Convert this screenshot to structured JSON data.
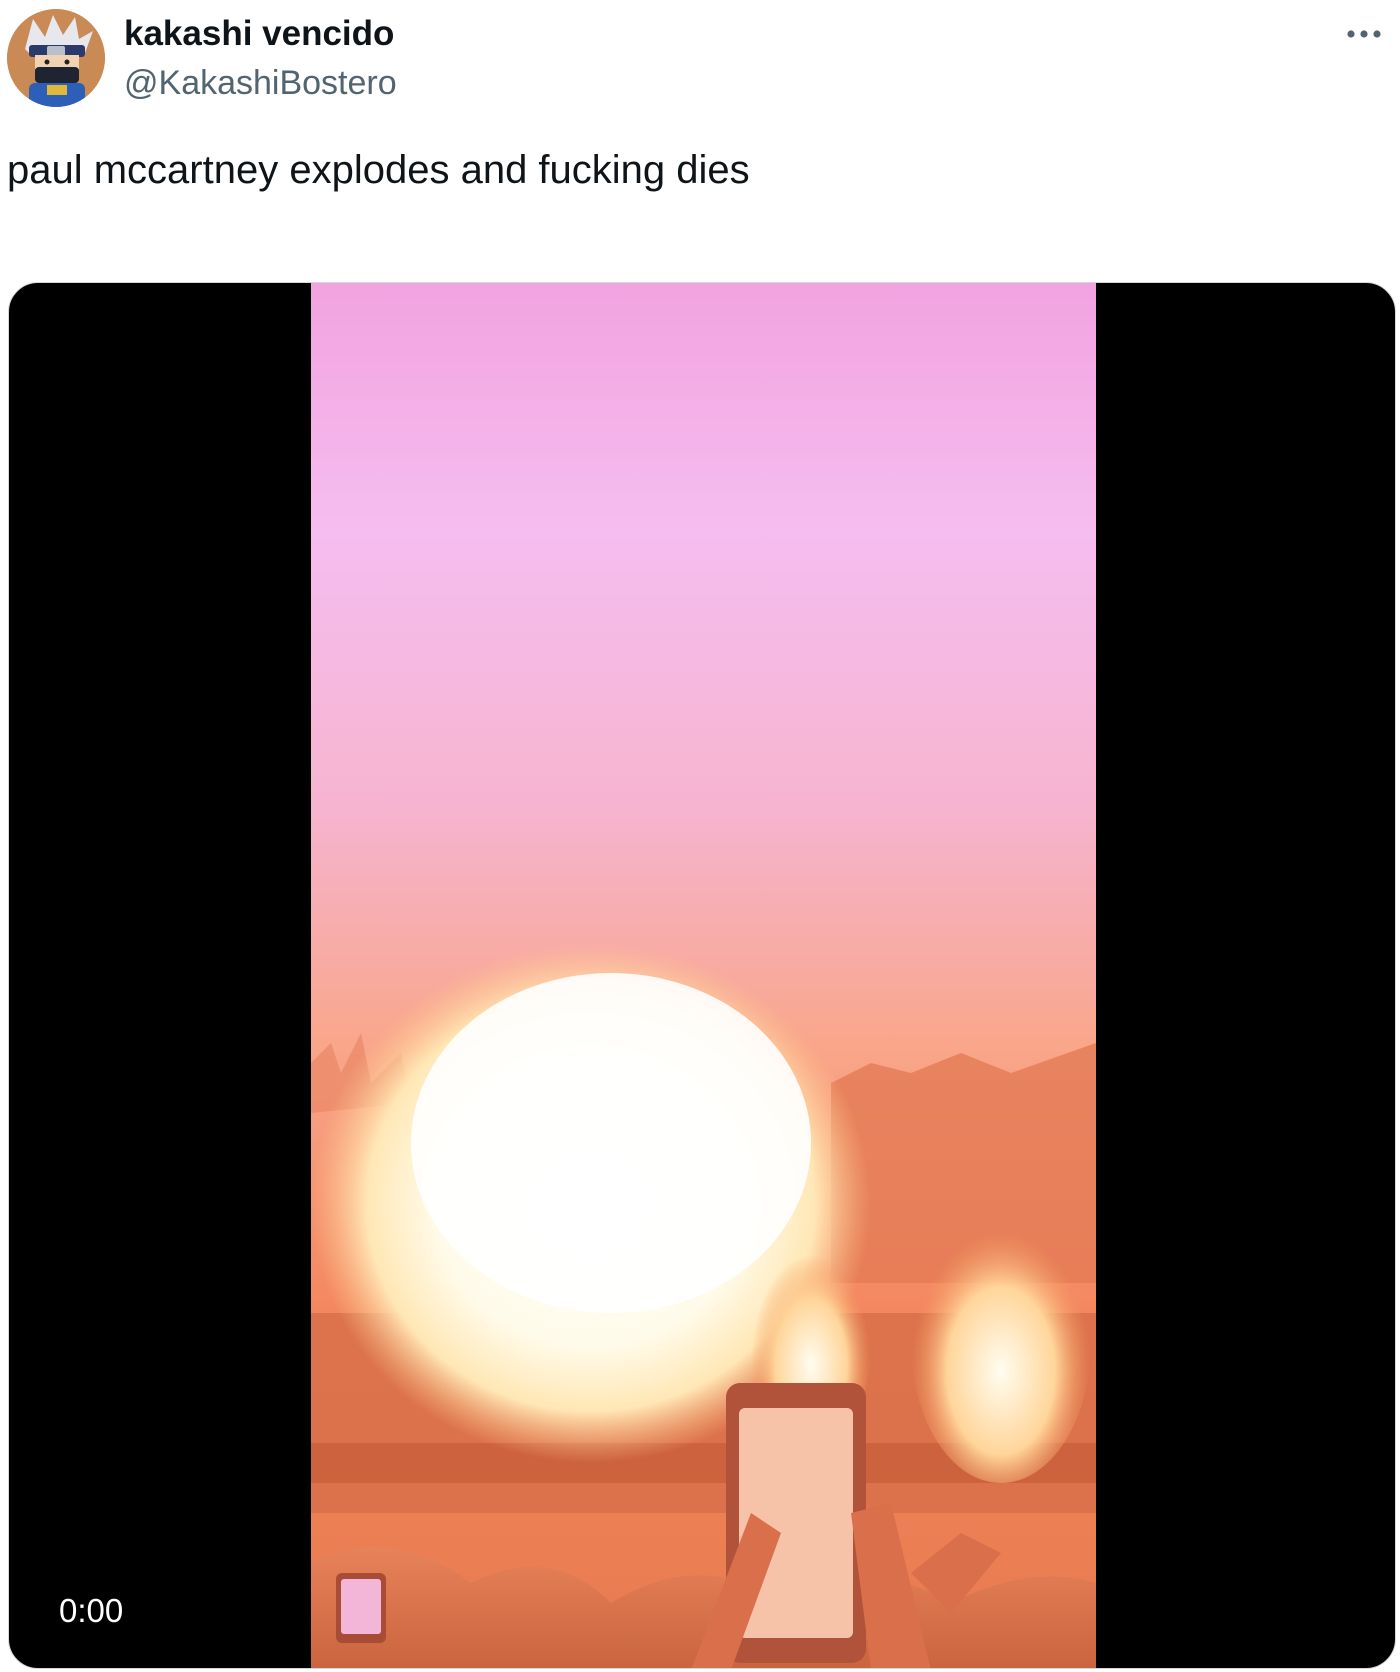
{
  "author": {
    "display_name": "kakashi vencido",
    "handle": "@KakashiBostero",
    "avatar_icon": "anime-ninja-avatar"
  },
  "more_icon": "more-horizontal-icon",
  "tweet": {
    "text": "paul mccartney explodes and fucking dies"
  },
  "media": {
    "type": "video",
    "timestamp": "0:00"
  },
  "colors": {
    "name": "#0f1419",
    "handle": "#536471",
    "media_bg": "#000000"
  }
}
